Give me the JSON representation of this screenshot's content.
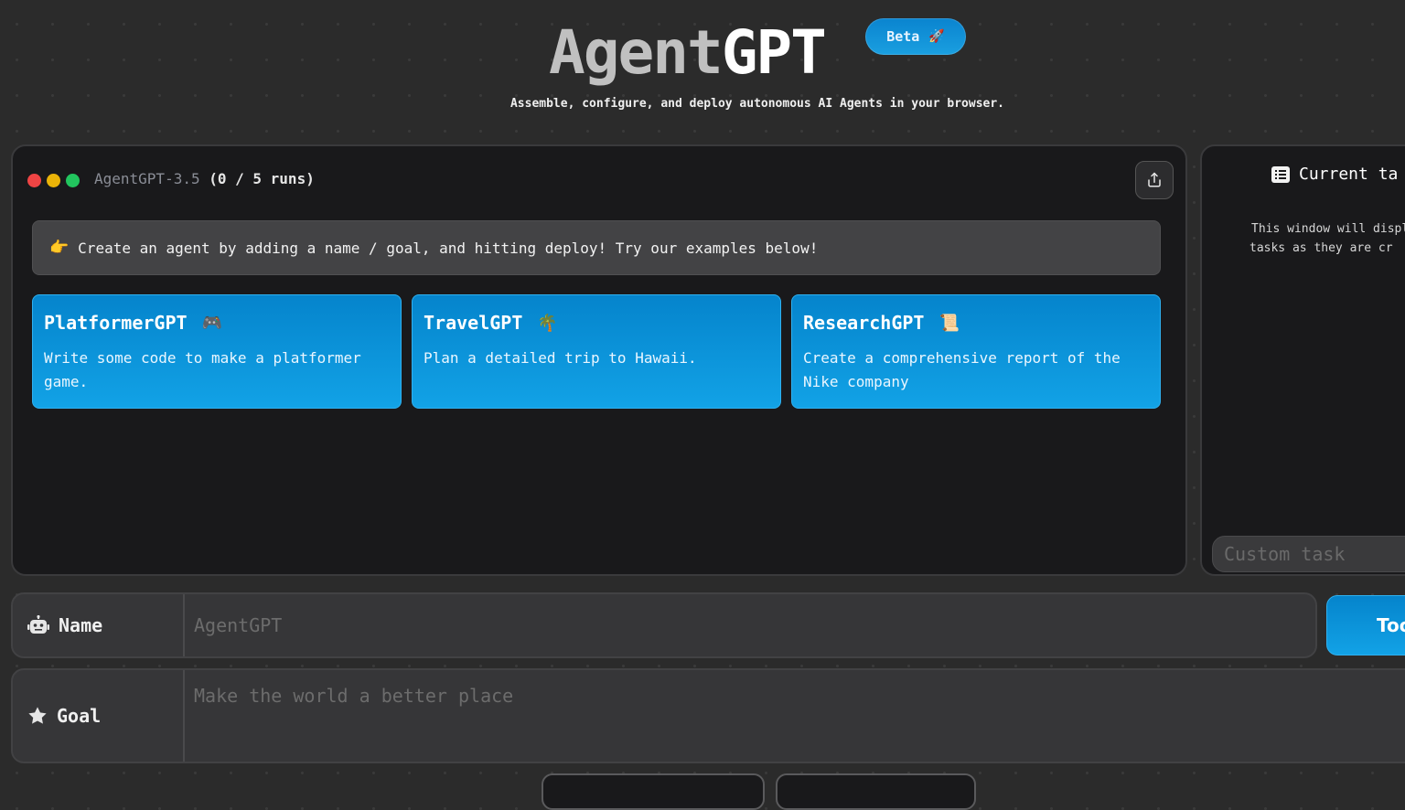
{
  "header": {
    "logo_part1": "Agent",
    "logo_part2": "GPT",
    "badge_label": "Beta",
    "badge_icon": "🚀",
    "tagline": "Assemble, configure, and deploy autonomous AI Agents in your browser."
  },
  "main_panel": {
    "window_dots": [
      {
        "name": "close",
        "color": "#ef4444"
      },
      {
        "name": "minimize",
        "color": "#eab308"
      },
      {
        "name": "maximize",
        "color": "#22c55e"
      }
    ],
    "model_name": "AgentGPT-3.5",
    "run_count": "(0 / 5 runs)",
    "share_icon": "share-icon",
    "banner_icon": "👉",
    "banner_text": "Create an agent by adding a name / goal, and hitting deploy! Try our examples below!",
    "examples": [
      {
        "title": "PlatformerGPT",
        "emoji": "🎮",
        "description": "Write some code to make a platformer game."
      },
      {
        "title": "TravelGPT",
        "emoji": "🌴",
        "description": "Plan a detailed trip to Hawaii."
      },
      {
        "title": "ResearchGPT",
        "emoji": "📜",
        "description": "Create a comprehensive report of the Nike company"
      }
    ]
  },
  "tasks_panel": {
    "title": "Current ta",
    "description_line1": "This window will displ",
    "description_line2": "tasks as they are cr",
    "custom_task_placeholder": "Custom task"
  },
  "form": {
    "name_label": "Name",
    "name_placeholder": "AgentGPT",
    "goal_label": "Goal",
    "goal_placeholder": "Make the world a better place",
    "tools_button_label": "Too"
  },
  "colors": {
    "accent": "#0ea5e9",
    "panel_bg": "#19191b",
    "page_bg": "#2b2b2b"
  }
}
